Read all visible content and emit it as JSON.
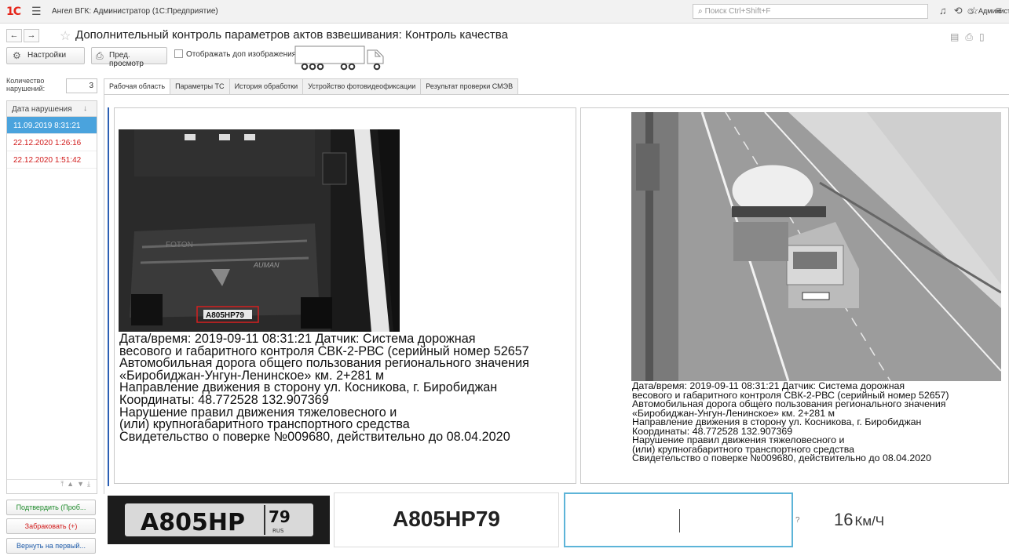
{
  "topbar": {
    "logo": "1С",
    "title": "Ангел ВГК: Администратор  (1С:Предприятие)",
    "search_placeholder": "Поиск Ctrl+Shift+F",
    "user": "Администратор"
  },
  "form": {
    "title": "Дополнительный контроль параметров актов взвешивания: Контроль качества",
    "back": "←",
    "forward": "→"
  },
  "toolbar": {
    "settings_label": "Настройки",
    "preview_label": "Пред. просмотр",
    "extra_images_label": "Отображать доп изображения",
    "extra_images_checked": false
  },
  "left_panel": {
    "count_label": "Количество нарушений:",
    "count_value": "3",
    "column_header": "Дата нарушения",
    "rows": [
      {
        "date": "11.09.2019 8:31:21",
        "selected": true
      },
      {
        "date": "22.12.2020 1:26:16",
        "selected": false
      },
      {
        "date": "22.12.2020 1:51:42",
        "selected": false
      }
    ],
    "confirm_button": "Подтвердить (Проб...",
    "reject_button": "Забраковать (+)",
    "return_button": "Вернуть на первый..."
  },
  "tabs": [
    {
      "label": "Рабочая область",
      "active": true
    },
    {
      "label": "Параметры ТС",
      "active": false
    },
    {
      "label": "История обработки",
      "active": false
    },
    {
      "label": "Устройство фотовидеофиксации",
      "active": false
    },
    {
      "label": "Результат проверки СМЭВ",
      "active": false
    }
  ],
  "photo": {
    "plate_on_photo": "А805НР79",
    "caption_lines": [
      "Дата/время: 2019-09-11 08:31:21 Датчик: Система дорожная",
      "весового и габаритного контроля СВК-2-РВС (серийный номер 52657)",
      "Автомобильная дорога общего пользования регионального значения",
      "«Биробиджан-Унгун-Ленинское» км. 2+281 м",
      "Направление движения в сторону ул. Косникова, г. Биробиджан",
      "Координаты: 48.772528 132.907369",
      "Нарушение правил движения тяжеловесного и",
      "(или) крупногабаритного транспортного средства",
      "Свидетельство о поверке №009680, действительно до 08.04.2020"
    ],
    "caption_lines_left": [
      "Дата/время: 2019-09-11 08:31:21 Датчик: Система дорожная",
      "весового и габаритного контроля СВК-2-РВС (серийный номер 52657",
      "Автомобильная дорога общего пользования регионального значения",
      "«Биробиджан-Унгун-Ленинское» км. 2+281 м",
      "Направление движения в сторону ул. Косникова, г. Биробиджан",
      "Координаты: 48.772528 132.907369",
      "Нарушение правил движения тяжеловесного и",
      "(или) крупногабаритного транспортного средства",
      "Свидетельство о поверке №009680, действительно до 08.04.2020"
    ]
  },
  "bottom": {
    "plate_image_text": "А805НР",
    "plate_image_region": "79",
    "plate_image_country": "RUS",
    "recognized_plate": "А805НР79",
    "plate_input_value": "",
    "question_mark": "?",
    "speed_value": "16",
    "speed_unit": "Км/Ч"
  }
}
